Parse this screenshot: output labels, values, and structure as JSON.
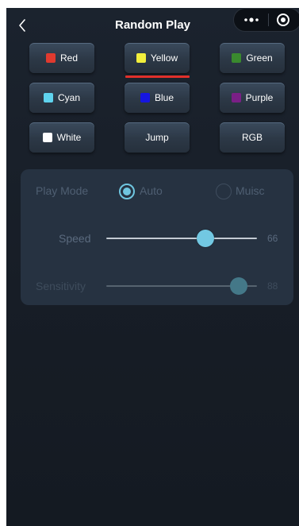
{
  "header": {
    "title": "Random Play"
  },
  "colors": [
    {
      "label": "Red",
      "swatch": "#e03a2f"
    },
    {
      "label": "Yellow",
      "swatch": "#f2ef3c",
      "selected": true
    },
    {
      "label": "Green",
      "swatch": "#3a8a2e"
    },
    {
      "label": "Cyan",
      "swatch": "#5fd3ee"
    },
    {
      "label": "Blue",
      "swatch": "#1616e0"
    },
    {
      "label": "Purple",
      "swatch": "#7a1f86"
    },
    {
      "label": "White",
      "swatch": "#ffffff"
    },
    {
      "label": "Jump"
    },
    {
      "label": "RGB"
    }
  ],
  "panel": {
    "play_mode_label": "Play Mode",
    "modes": [
      {
        "label": "Auto",
        "selected": true
      },
      {
        "label": "Muisc",
        "selected": false
      }
    ],
    "speed": {
      "label": "Speed",
      "value": "66",
      "level": 0.66
    },
    "sensitivity": {
      "label": "Sensitivity",
      "value": "88",
      "level": 0.88,
      "enabled": false
    }
  },
  "theme": {
    "accent": "#6fc6e0",
    "selected_underline": "#e0302b"
  }
}
